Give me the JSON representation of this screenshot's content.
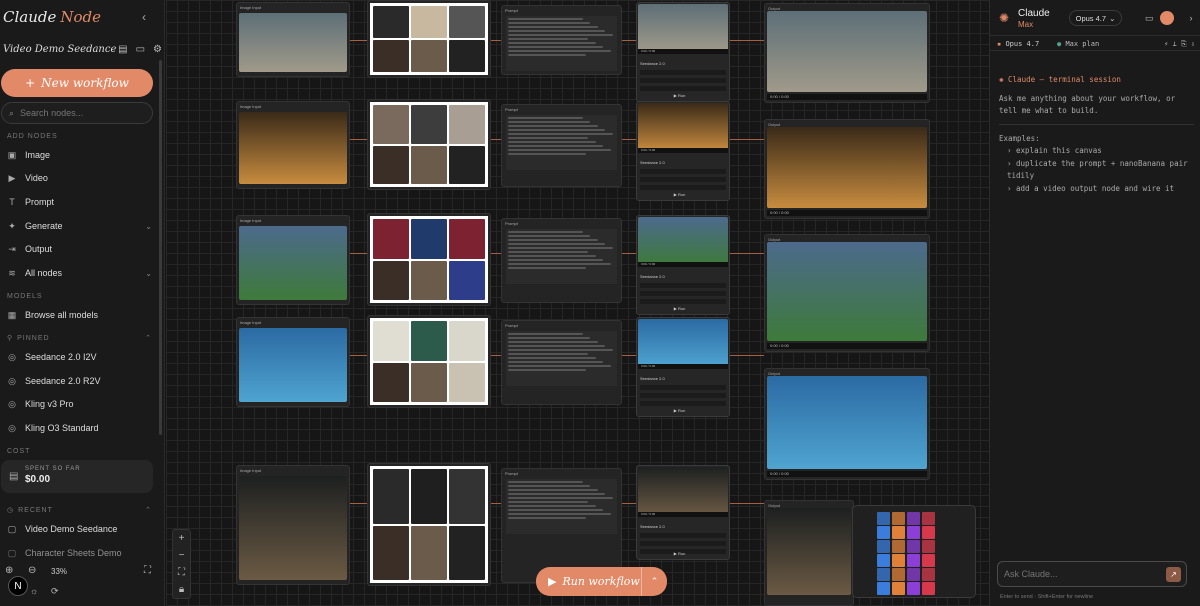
{
  "sidebar": {
    "brand_main": "Claude",
    "brand_accent": "Node",
    "workspace_name": "Video Demo Seedance",
    "new_workflow": "New workflow",
    "search_placeholder": "Search nodes...",
    "add_nodes_label": "ADD NODES",
    "add_nodes": [
      {
        "label": "Image",
        "icon": "image-icon"
      },
      {
        "label": "Video",
        "icon": "video-icon"
      },
      {
        "label": "Prompt",
        "icon": "text-icon"
      },
      {
        "label": "Generate",
        "icon": "sparkle-icon"
      },
      {
        "label": "Output",
        "icon": "output-icon"
      },
      {
        "label": "All nodes",
        "icon": "layers-icon"
      }
    ],
    "models_label": "MODELS",
    "browse_models": "Browse all models",
    "pinned_label": "PINNED",
    "pinned": [
      "Seedance 2.0 I2V",
      "Seedance 2.0 R2V",
      "Kling v3 Pro",
      "Kling O3 Standard"
    ],
    "cost_label": "COST",
    "spent_label": "SPENT SO FAR",
    "spent_value": "$0.00",
    "recent_label": "RECENT",
    "recent": [
      "Video Demo Seedance",
      "Character Sheets Demo"
    ],
    "zoom": "33%"
  },
  "canvas": {
    "image_input_label": "Image Input",
    "prompt_label": "Prompt",
    "output_label": "Output",
    "model_label": "Seedance 2.0",
    "run_label": "Run",
    "run_workflow": "Run workflow",
    "video_time": "0:00 / 0:00"
  },
  "panel": {
    "title": "Claude",
    "plan": "Max",
    "model": "Opus 4.7",
    "status_model": "Opus 4.7",
    "status_plan": "Max plan",
    "session_title": "Claude — terminal session",
    "intro": "Ask me anything about your workflow, or tell me what to build.",
    "examples_label": "Examples:",
    "examples": [
      "explain this canvas",
      "duplicate the prompt + nanoBanana pair tidily",
      "add a video output node and wire it"
    ],
    "ask_placeholder": "Ask Claude...",
    "ask_hint": "Enter to send · Shift+Enter for newline"
  },
  "colors": {
    "accent": "#e28a68",
    "wire": "#a55f43",
    "background": "#141414"
  }
}
